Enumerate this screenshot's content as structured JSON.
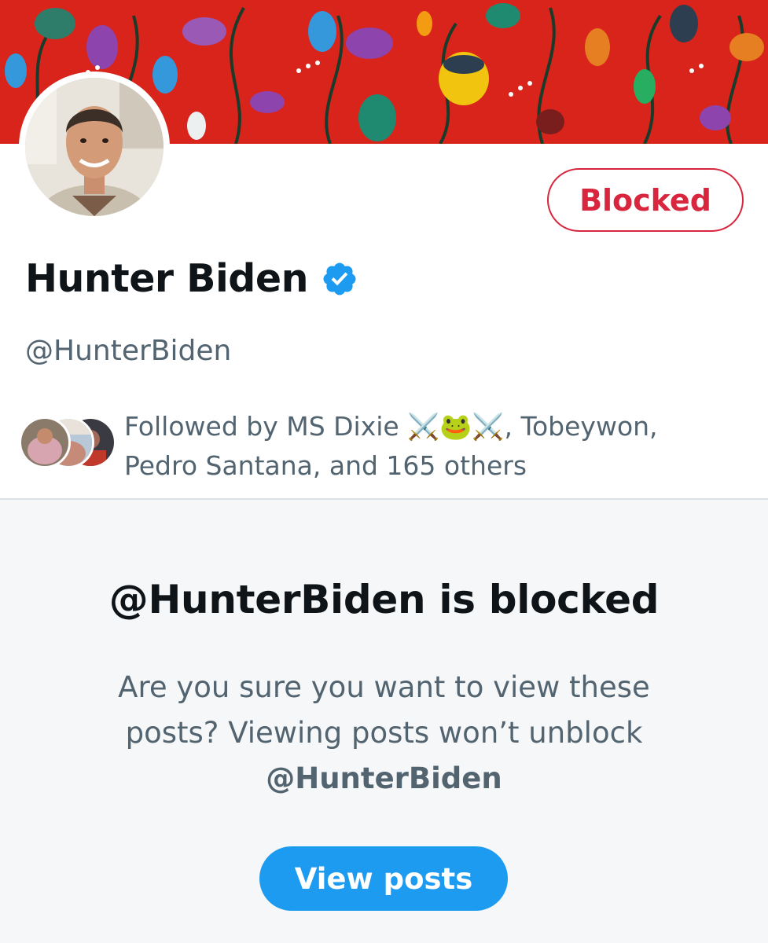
{
  "profile": {
    "display_name": "Hunter Biden",
    "handle": "@HunterBiden",
    "verified_icon": "verified-badge-icon",
    "blocked_button_label": "Blocked"
  },
  "followed_by": {
    "text": "Followed by MS Dixie ⚔️🐸⚔️, Tobeywon, Pedro Santana, and 165 others"
  },
  "blocked_notice": {
    "title": "@HunterBiden is blocked",
    "description": "Are you sure you want to view these posts? Viewing posts won’t unblock",
    "handle": "@HunterBiden",
    "view_button_label": "View posts"
  },
  "colors": {
    "blocked_red": "#d7263d",
    "accent_blue": "#1d9bf0",
    "secondary_text": "#536471",
    "banner_red": "#d8241b"
  }
}
